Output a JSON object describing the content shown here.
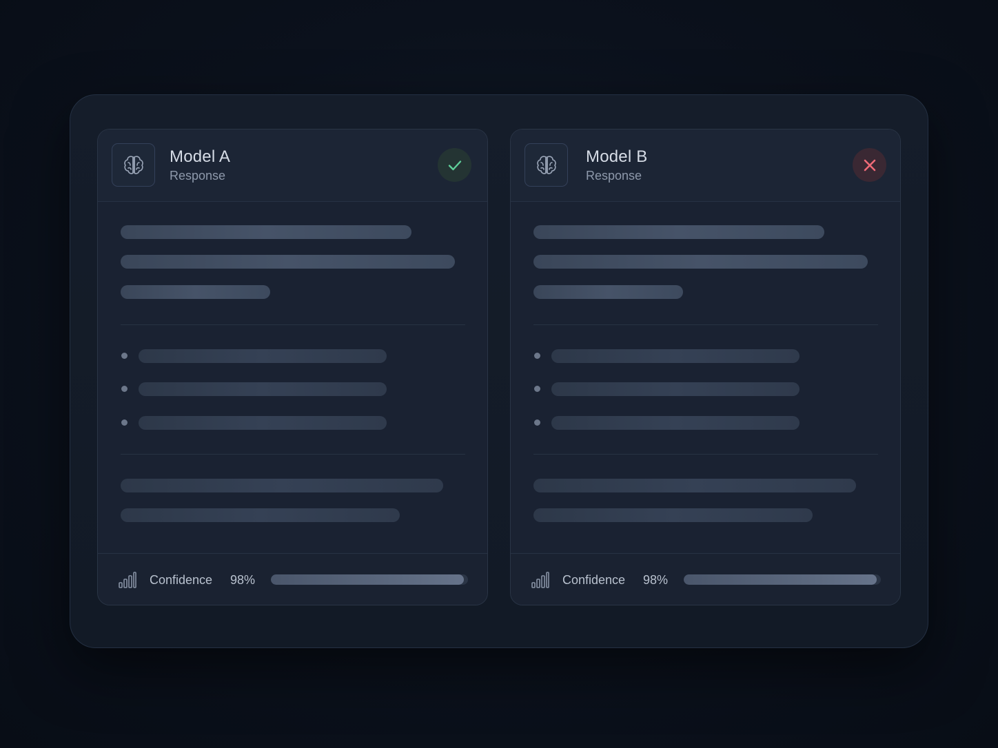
{
  "panels": [
    {
      "title": "Model A",
      "subtitle": "Response",
      "status": "approved",
      "status_icon": "check-icon",
      "status_color": "#5fcf9a",
      "confidence_label": "Confidence",
      "confidence_value": "98%",
      "confidence_fraction": 0.98
    },
    {
      "title": "Model B",
      "subtitle": "Response",
      "status": "rejected",
      "status_icon": "close-icon",
      "status_color": "#f06b78",
      "confidence_label": "Confidence",
      "confidence_value": "98%",
      "confidence_fraction": 0.98
    }
  ],
  "colors": {
    "background": "#0b111c",
    "panel": "#1a2232",
    "placeholder_bar": "#3f4b5f"
  }
}
